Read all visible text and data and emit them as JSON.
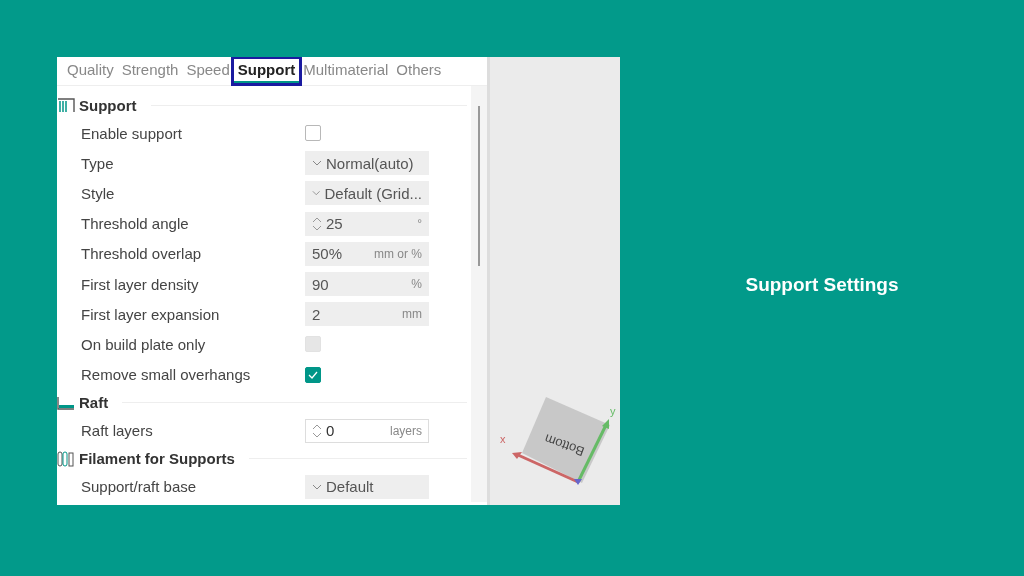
{
  "tabs": [
    {
      "label": "Quality",
      "selected": false
    },
    {
      "label": "Strength",
      "selected": false
    },
    {
      "label": "Speed",
      "selected": false
    },
    {
      "label": "Support",
      "selected": true
    },
    {
      "label": "Multimaterial",
      "selected": false
    },
    {
      "label": "Others",
      "selected": false
    }
  ],
  "sections": [
    {
      "title": "Support",
      "rows": [
        {
          "kind": "checkbox",
          "label": "Enable support",
          "checked": false,
          "disabled": false
        },
        {
          "kind": "dropdown",
          "label": "Type",
          "value": "Normal(auto)",
          "disabled": true
        },
        {
          "kind": "dropdown",
          "label": "Style",
          "value": "Default (Grid...",
          "disabled": true
        },
        {
          "kind": "spin",
          "label": "Threshold angle",
          "value": "25",
          "unit": "°",
          "disabled": true
        },
        {
          "kind": "input",
          "label": "Threshold overlap",
          "value": "50%",
          "unit": "mm or %",
          "disabled": true
        },
        {
          "kind": "input",
          "label": "First layer density",
          "value": "90",
          "unit": "%",
          "disabled": true
        },
        {
          "kind": "input",
          "label": "First layer expansion",
          "value": "2",
          "unit": "mm",
          "disabled": true
        },
        {
          "kind": "checkbox",
          "label": "On build plate only",
          "checked": false,
          "disabled": true
        },
        {
          "kind": "checkbox",
          "label": "Remove small overhangs",
          "checked": true,
          "disabled": false
        }
      ]
    },
    {
      "title": "Raft",
      "rows": [
        {
          "kind": "spin",
          "label": "Raft layers",
          "value": "0",
          "unit": "layers",
          "disabled": false
        }
      ]
    },
    {
      "title": "Filament for Supports",
      "rows": [
        {
          "kind": "dropdown",
          "label": "Support/raft base",
          "value": "Default",
          "disabled": true
        }
      ]
    }
  ],
  "view_cube": {
    "face": "Bottom",
    "x_label": "x",
    "y_label": "y"
  },
  "caption": "Support Settings"
}
